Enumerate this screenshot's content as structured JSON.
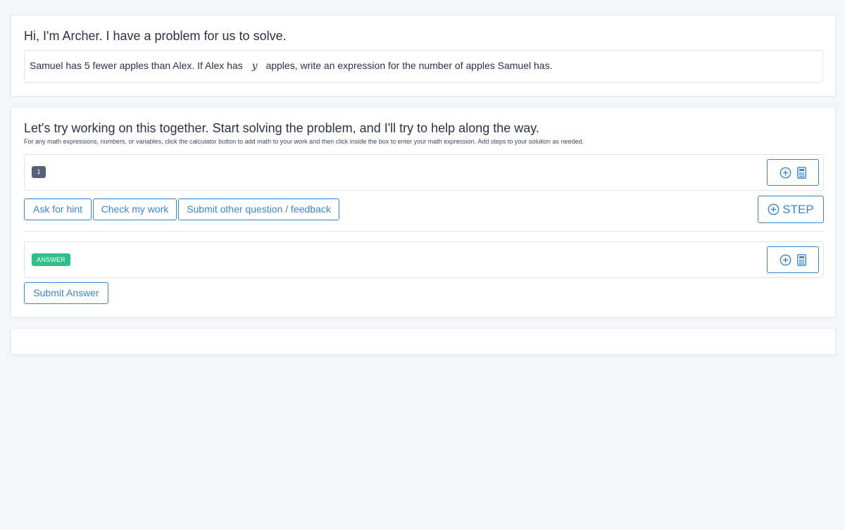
{
  "intro": {
    "greeting": "Hi, I'm Archer. I have a problem for us to solve.",
    "problem_before": "Samuel has 5 fewer apples than Alex. If Alex has",
    "problem_variable": "y",
    "problem_after": "apples, write an expression for the number of apples Samuel has."
  },
  "work": {
    "heading": "Let's try working on this together. Start solving the problem, and I'll try to help along the way.",
    "instructions": "For any math expressions, numbers, or variables, click the calculator button to add math to your work and then click inside the box to enter your math expression. Add steps to your solution as needed.",
    "step_number": "1",
    "buttons": {
      "hint": "Ask for hint",
      "check": "Check my work",
      "feedback": "Submit other question / feedback",
      "step": "STEP"
    },
    "answer_badge": "ANSWER",
    "submit_answer": "Submit Answer"
  },
  "icons": {
    "add": "plus-circle-icon",
    "calculator": "calculator-icon"
  },
  "colors": {
    "accent": "#3b86c6",
    "answer_badge": "#2fbf88",
    "step_badge": "#56607a",
    "background": "#f4f6f9"
  }
}
